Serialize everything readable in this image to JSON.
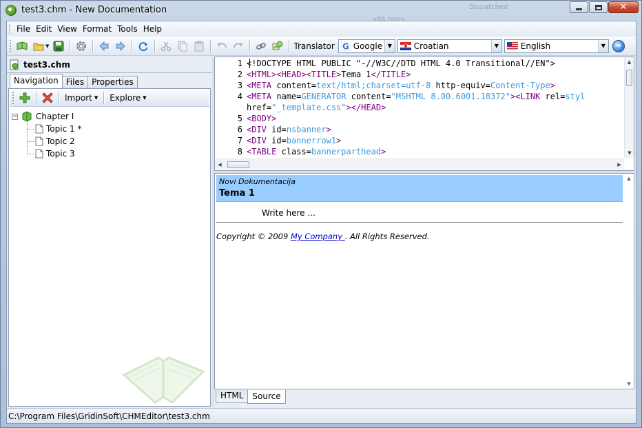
{
  "window": {
    "title": "test3.chm - New Documentation",
    "bg_text_1": "Dispatched",
    "bg_text_2": "x86 tools"
  },
  "menu": [
    "File",
    "Edit",
    "View",
    "Format",
    "Tools",
    "Help"
  ],
  "toolbar": {
    "translator_label": "Translator",
    "engine": "Google",
    "from_language": "Croatian",
    "to_language": "English"
  },
  "left": {
    "doc_name": "test3.chm",
    "tabs": [
      "Navigation",
      "Files",
      "Properties"
    ],
    "active_tab": "Navigation",
    "nav_toolbar": {
      "import": "Import",
      "explore": "Explore"
    },
    "tree": {
      "chapter": "Chapter I",
      "expander": "−",
      "topics": [
        "Topic 1 *",
        "Topic 2",
        "Topic 3"
      ]
    }
  },
  "editor": {
    "lines": [
      {
        "n": "1",
        "parts": [
          [
            "p",
            "<!DOCTYPE HTML PUBLIC \"-//W3C//DTD HTML 4.0 Transitional//EN\">"
          ]
        ]
      },
      {
        "n": "2",
        "parts": [
          [
            "t",
            "<HTML><HEAD><TITLE>"
          ],
          [
            "p",
            "Tema 1"
          ],
          [
            "t",
            "</TITLE>"
          ]
        ]
      },
      {
        "n": "3",
        "parts": [
          [
            "t",
            "<META "
          ],
          [
            "p",
            "content="
          ],
          [
            "v",
            "text/html;charset=utf-8"
          ],
          [
            "p",
            " http-equiv="
          ],
          [
            "v",
            "Content-Type"
          ],
          [
            "t",
            ">"
          ]
        ]
      },
      {
        "n": "4",
        "parts": [
          [
            "t",
            "<META "
          ],
          [
            "p",
            "name="
          ],
          [
            "v",
            "GENERATOR"
          ],
          [
            "p",
            " content="
          ],
          [
            "v",
            "\"MSHTML 8.00.6001.18372\""
          ],
          [
            "t",
            "><LINK "
          ],
          [
            "p",
            "rel="
          ],
          [
            "v",
            "styl"
          ]
        ]
      },
      {
        "n": "",
        "parts": [
          [
            "p",
            "href="
          ],
          [
            "v",
            "\"_template.css\""
          ],
          [
            "t",
            "></HEAD>"
          ]
        ]
      },
      {
        "n": "5",
        "parts": [
          [
            "t",
            "<BODY>"
          ]
        ]
      },
      {
        "n": "6",
        "parts": [
          [
            "t",
            "<DIV "
          ],
          [
            "p",
            "id="
          ],
          [
            "v",
            "nsbanner"
          ],
          [
            "t",
            ">"
          ]
        ]
      },
      {
        "n": "7",
        "parts": [
          [
            "t",
            "<DIV "
          ],
          [
            "p",
            "id="
          ],
          [
            "v",
            "bannerrow1"
          ],
          [
            "t",
            ">"
          ]
        ]
      },
      {
        "n": "8",
        "parts": [
          [
            "t",
            "<TABLE "
          ],
          [
            "p",
            "class="
          ],
          [
            "v",
            "bannerparthead"
          ],
          [
            "t",
            ">"
          ]
        ]
      }
    ],
    "scroll_up": "▲",
    "scroll_down": "▼",
    "scroll_left": "◀",
    "scroll_right": "▶"
  },
  "preview": {
    "banner_subtitle": "Novi Dokumentacija",
    "banner_title": "Tema 1",
    "body_text": "Write here ...",
    "copyright_prefix": "Copyright © 2009 ",
    "copyright_link": "My Company ",
    "copyright_suffix": ". All Rights Reserved.",
    "banner_color": "#99ccff"
  },
  "bottom_tabs": [
    "HTML",
    "Source"
  ],
  "active_bottom_tab": "Source",
  "status": {
    "path": "C:\\Program Files\\GridinSoft\\CHMEditor\\test3.chm"
  },
  "icons": [
    "app-icon",
    "open-book-icon",
    "folder-icon",
    "save-icon",
    "settings-icon",
    "back-arrow-icon",
    "forward-arrow-icon",
    "refresh-icon",
    "cut-icon",
    "copy-icon",
    "paste-icon",
    "undo-icon",
    "redo-icon",
    "link-icon",
    "image-icon",
    "google-icon",
    "croatia-flag-icon",
    "us-flag-icon",
    "go-icon",
    "add-icon",
    "delete-icon",
    "book-icon",
    "page-icon"
  ]
}
